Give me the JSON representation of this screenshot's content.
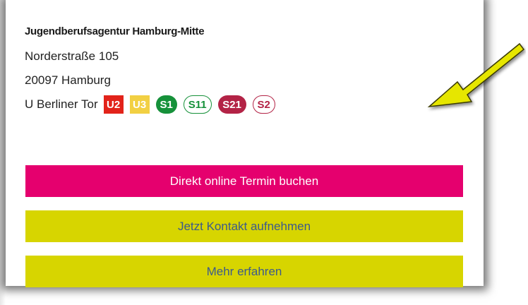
{
  "agency": {
    "title": "Jugendberufsagentur Hamburg-Mitte",
    "street": "Norderstraße 105",
    "city": "20097 Hamburg",
    "stop": "U Berliner Tor"
  },
  "lines": [
    {
      "label": "U2",
      "color": "#e2231a"
    },
    {
      "label": "U3",
      "color": "#f2d043"
    },
    {
      "label": "S1",
      "color": "#16913a"
    },
    {
      "label": "S11",
      "color": "#16913a"
    },
    {
      "label": "S21",
      "color": "#b32346"
    },
    {
      "label": "S2",
      "color": "#b32346"
    }
  ],
  "buttons": {
    "book_online": "Direkt online Termin buchen",
    "contact": "Jetzt Kontakt aufnehmen",
    "more": "Mehr erfahren"
  },
  "colors": {
    "primary": "#e5006e",
    "secondary": "#d7d500",
    "secondary_text": "#3c5a8c",
    "arrow": "#e6e600"
  },
  "annotation": {
    "icon": "arrow-icon"
  }
}
